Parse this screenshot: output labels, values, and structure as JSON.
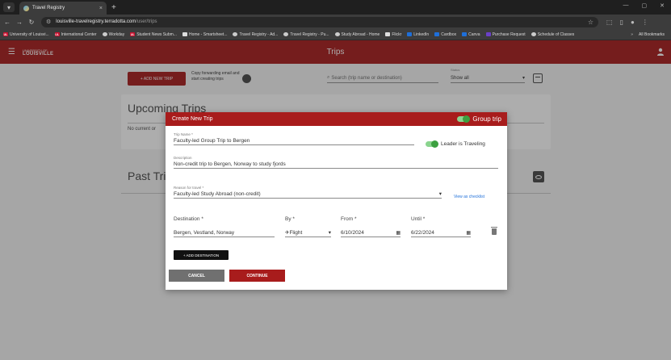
{
  "browser": {
    "tab_title": "Travel Registry",
    "tab_close": "×",
    "new_tab": "+",
    "url_domain": "louisville-travelregistry.terradotta.com",
    "url_path": "/user/trips",
    "bookmarks": [
      {
        "icon": "UL",
        "label": "University of Louisvi..."
      },
      {
        "icon": "UL",
        "label": "International Center"
      },
      {
        "icon": "",
        "label": "Workday"
      },
      {
        "icon": "UL",
        "label": "Student News Subm..."
      },
      {
        "icon": "",
        "label": "Home - Smartsheet..."
      },
      {
        "icon": "",
        "label": "Travel Registry - Ad..."
      },
      {
        "icon": "",
        "label": "Travel Registry - Pu..."
      },
      {
        "icon": "",
        "label": "Study Abroad - Home"
      },
      {
        "icon": "",
        "label": "Flickr"
      },
      {
        "icon": "",
        "label": "LinkedIn"
      },
      {
        "icon": "",
        "label": "Cardbox"
      },
      {
        "icon": "",
        "label": "Canva"
      },
      {
        "icon": "",
        "label": "Purchase Request"
      },
      {
        "icon": "",
        "label": "Schedule of Classes"
      }
    ],
    "bookmarks_more": "»",
    "all_bookmarks": "All Bookmarks"
  },
  "app": {
    "logo_top": "UNIVERSITY OF",
    "logo_main": "LOUISVILLE",
    "title": "Trips",
    "accent": "#ad2c2c"
  },
  "page": {
    "add_button": "+ ADD NEW TRIP",
    "forward_text": "Copy forwarding email and start creating trips",
    "search_placeholder": "Search (trip name or destination)",
    "status_label": "Status",
    "status_value": "Show all",
    "upcoming_title": "Upcoming Trips",
    "upcoming_empty": "No current or",
    "past_title": "Past Tri"
  },
  "modal": {
    "title": "Create New Trip",
    "group_trip_label": "Group trip",
    "trip_name_label": "Trip Name *",
    "trip_name_value": "Faculty-led Group Trip to Bergen",
    "leader_label": "Leader is Traveling",
    "description_label": "Description",
    "description_value": "Non-credit trip to Bergen, Norway to study fjords",
    "reason_label": "Reason for travel *",
    "reason_value": "Faculty-led Study Abroad (non-credit)",
    "checklist_link": "View as checklist",
    "destination_label": "Destination *",
    "destination_value": "Bergen, Vestland, Norway",
    "by_label": "By *",
    "by_value": "Flight",
    "from_label": "From *",
    "from_value": "6/10/2024",
    "until_label": "Until *",
    "until_value": "6/22/2024",
    "add_destination": "+ ADD DESTINATION",
    "cancel": "CANCEL",
    "continue": "CONTINUE",
    "header_color": "#a81c1c"
  }
}
